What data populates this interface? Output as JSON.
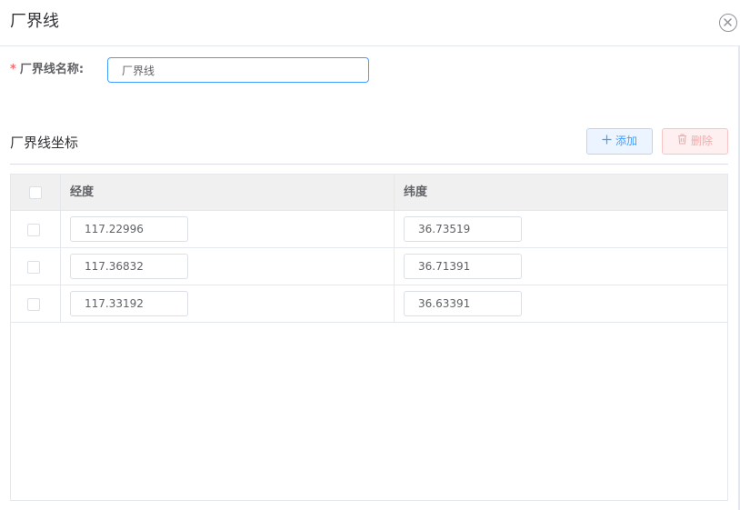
{
  "dialog": {
    "title": "厂界线",
    "close_icon": "close-circle-icon"
  },
  "form": {
    "name_label": "厂界线名称:",
    "required_mark": "*",
    "name_value": "厂界线"
  },
  "coords_section": {
    "title": "厂界线坐标",
    "add_button": "添加",
    "add_icon": "plus-icon",
    "delete_button": "删除",
    "delete_icon": "trash-icon"
  },
  "table": {
    "columns": [
      "经度",
      "纬度"
    ],
    "rows": [
      {
        "longitude": "117.22996",
        "latitude": "36.73519"
      },
      {
        "longitude": "117.36832",
        "latitude": "36.71391"
      },
      {
        "longitude": "117.33192",
        "latitude": "36.63391"
      }
    ]
  },
  "colors": {
    "primary": "#409eff",
    "danger": "#f56c6c"
  }
}
